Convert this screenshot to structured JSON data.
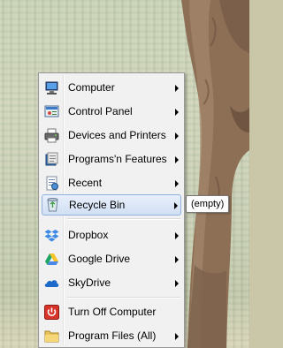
{
  "menu": {
    "items": [
      {
        "label": "Computer",
        "icon": "computer-icon",
        "submenu": true
      },
      {
        "label": "Control Panel",
        "icon": "control-panel-icon",
        "submenu": true
      },
      {
        "label": "Devices and Printers",
        "icon": "printer-icon",
        "submenu": true
      },
      {
        "label": "Programs'n Features",
        "icon": "programs-icon",
        "submenu": true
      },
      {
        "label": "Recent",
        "icon": "recent-icon",
        "submenu": true
      },
      {
        "label": "Recycle Bin",
        "icon": "recycle-bin-icon",
        "submenu": true,
        "selected": true
      },
      {
        "label": "Dropbox",
        "icon": "dropbox-icon",
        "submenu": true
      },
      {
        "label": "Google Drive",
        "icon": "google-drive-icon",
        "submenu": true
      },
      {
        "label": "SkyDrive",
        "icon": "skydrive-icon",
        "submenu": true
      },
      {
        "label": "Turn Off Computer",
        "icon": "power-icon",
        "submenu": false
      },
      {
        "label": "Program Files (All)",
        "icon": "folder-icon",
        "submenu": true
      }
    ]
  },
  "tooltip": {
    "text": "(empty)"
  },
  "colors": {
    "selection": "#d2e0f5",
    "selection_border": "#8fb1dc",
    "menu_bg": "#f1f1f1"
  }
}
